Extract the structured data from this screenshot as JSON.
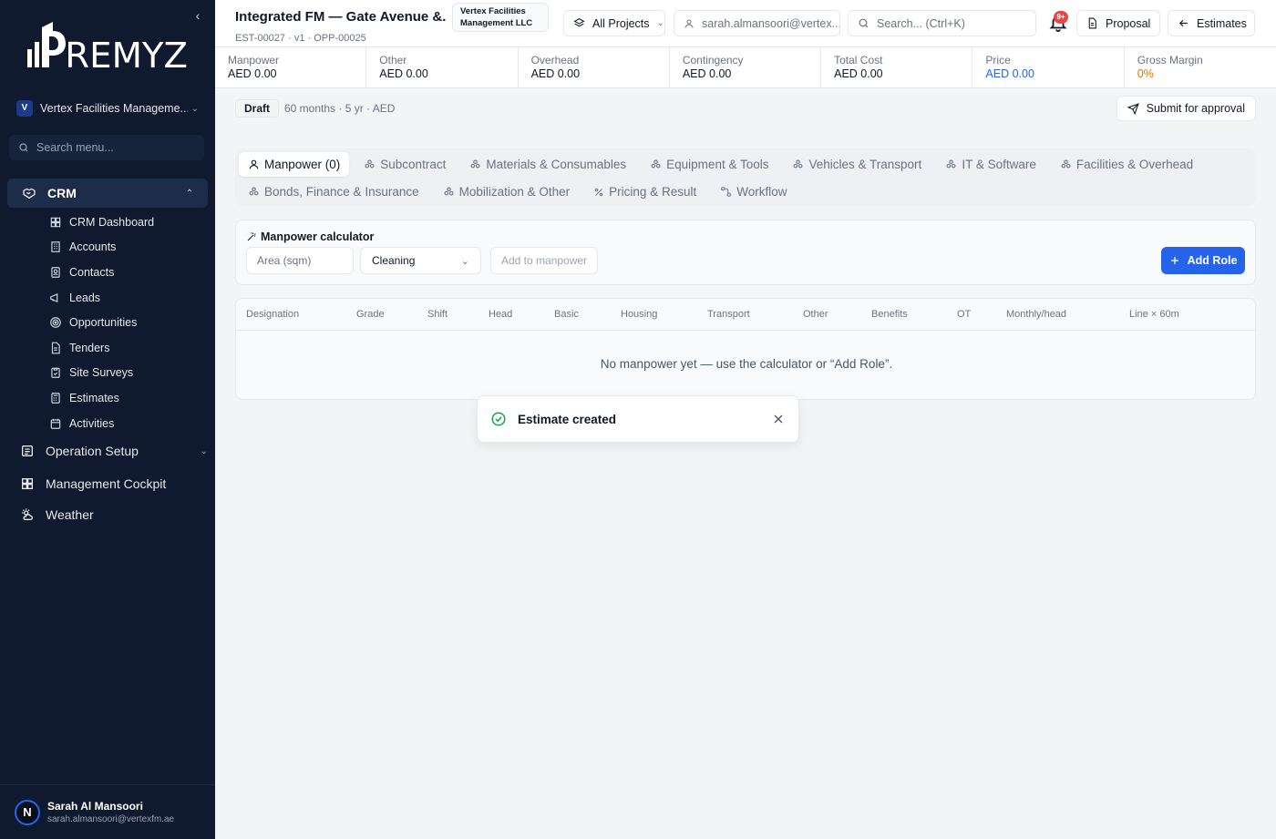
{
  "sidebar": {
    "brand": "PREMYZ",
    "org": {
      "initial": "V",
      "name": "Vertex Facilities Manageme..."
    },
    "search_placeholder": "Search menu...",
    "crm": {
      "label": "CRM",
      "items": [
        {
          "label": "CRM Dashboard",
          "icon": "dashboard-icon"
        },
        {
          "label": "Accounts",
          "icon": "building-icon"
        },
        {
          "label": "Contacts",
          "icon": "contact-icon"
        },
        {
          "label": "Leads",
          "icon": "megaphone-icon"
        },
        {
          "label": "Opportunities",
          "icon": "target-icon"
        },
        {
          "label": "Tenders",
          "icon": "file-icon"
        },
        {
          "label": "Site Surveys",
          "icon": "clipboard-icon"
        },
        {
          "label": "Estimates",
          "icon": "calculator-icon"
        },
        {
          "label": "Activities",
          "icon": "calendar-icon"
        }
      ]
    },
    "nav": [
      {
        "label": "Operation Setup",
        "icon": "operations-icon",
        "expandable": true
      },
      {
        "label": "Management Cockpit",
        "icon": "grid-icon",
        "expandable": false
      },
      {
        "label": "Weather",
        "icon": "weather-icon",
        "expandable": false
      }
    ],
    "user": {
      "initial": "N",
      "name": "Sarah Al Mansoori",
      "email": "sarah.almansoori@vertexfm.ae"
    }
  },
  "header": {
    "title": "Integrated FM — Gate Avenue &...",
    "subtitle": "EST-00027 · v1 · OPP-00025",
    "company_tag": "Vertex Facilities Management LLC",
    "projects": "All Projects",
    "user_email": "sarah.almansoori@vertex...",
    "search_placeholder": "Search... (Ctrl+K)",
    "notif_badge": "9+",
    "proposal": "Proposal",
    "estimates": "Estimates"
  },
  "metrics": [
    {
      "label": "Manpower",
      "value": "AED 0.00",
      "color": "#111827"
    },
    {
      "label": "Other",
      "value": "AED 0.00",
      "color": "#111827"
    },
    {
      "label": "Overhead",
      "value": "AED 0.00",
      "color": "#111827"
    },
    {
      "label": "Contingency",
      "value": "AED 0.00",
      "color": "#111827"
    },
    {
      "label": "Total Cost",
      "value": "AED 0.00",
      "color": "#111827"
    },
    {
      "label": "Price",
      "value": "AED 0.00",
      "color": "#2563eb"
    },
    {
      "label": "Gross Margin",
      "value": "0%",
      "color": "#d97706"
    }
  ],
  "status": {
    "badge": "Draft",
    "meta": "60 months · 5 yr · AED",
    "submit": "Submit for approval"
  },
  "tabs": {
    "row1": [
      "Manpower (0)",
      "Subcontract",
      "Materials & Consumables",
      "Equipment & Tools",
      "Vehicles & Transport",
      "IT & Software",
      "Facilities & Overhead"
    ],
    "row2": [
      "Bonds, Finance & Insurance",
      "Mobilization & Other",
      "Pricing & Result",
      "Workflow"
    ]
  },
  "calculator": {
    "title": "Manpower calculator",
    "area_placeholder": "Area (sqm)",
    "type_value": "Cleaning",
    "add_to_manpower": "Add to manpower",
    "add_role": "Add Role"
  },
  "table": {
    "columns": [
      "Designation",
      "Grade",
      "Shift",
      "Head",
      "Basic",
      "Housing",
      "Transport",
      "Other",
      "Benefits",
      "OT",
      "Monthly/head",
      "Line × 60m"
    ],
    "empty": "No manpower yet — use the calculator or “Add Role”."
  },
  "toast": {
    "message": "Estimate created"
  },
  "colors": {
    "sidebar_bg": "#0f1a2e",
    "accent": "#2563eb",
    "success": "#16a34a",
    "warning": "#d97706",
    "danger": "#ef4444"
  }
}
